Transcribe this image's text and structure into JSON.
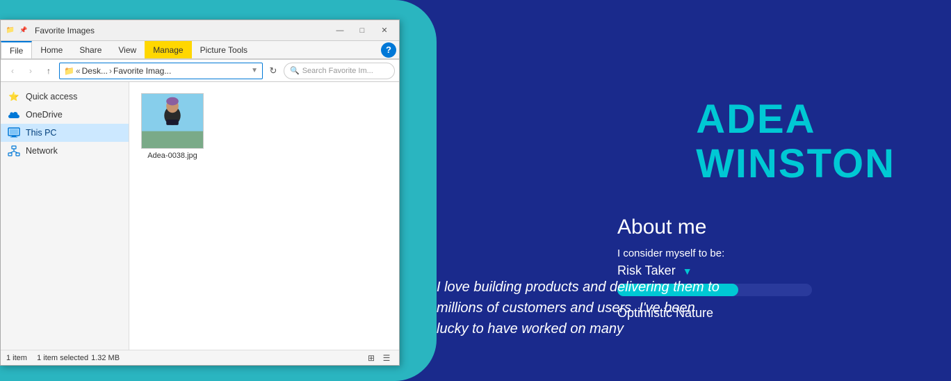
{
  "background": {
    "teal_color": "#2ab5c0",
    "dark_blue_color": "#1a2a8c"
  },
  "explorer": {
    "title": "Favorite Images",
    "window_controls": {
      "minimize": "—",
      "maximize": "□",
      "close": "✕"
    },
    "ribbon_tabs": [
      {
        "label": "File",
        "active": true
      },
      {
        "label": "Home",
        "active": false
      },
      {
        "label": "Share",
        "active": false
      },
      {
        "label": "View",
        "active": false
      },
      {
        "label": "Manage",
        "active": false,
        "special": "manage"
      },
      {
        "label": "Picture Tools",
        "active": false,
        "special": "picture_tools"
      }
    ],
    "nav": {
      "back": "‹",
      "forward": "›",
      "up": "↑",
      "breadcrumb": "« Desk... › Favorite Imag...",
      "refresh": "↻",
      "search_placeholder": "Search Favorite Im..."
    },
    "sidebar": {
      "items": [
        {
          "label": "Quick access",
          "icon": "star",
          "active": false
        },
        {
          "label": "OneDrive",
          "icon": "cloud",
          "active": false
        },
        {
          "label": "This PC",
          "icon": "pc",
          "active": true
        },
        {
          "label": "Network",
          "icon": "network",
          "active": false
        }
      ]
    },
    "files": [
      {
        "name": "Adea-0038.jpg",
        "type": "image"
      }
    ],
    "status_bar": {
      "item_count": "1 item",
      "selection": "1 item selected",
      "size": "1.32 MB"
    }
  },
  "profile": {
    "name_line1": "ADEA",
    "name_line2": "WINSTON",
    "about_title": "About me",
    "consider_label": "I consider myself to be:",
    "risk_taker": "Risk Taker",
    "progress_percent": 62,
    "optimistic": "Optimistic Nature",
    "quote": "I love building products and delivering them to millions of customers and users. I've been lucky to have worked on many"
  }
}
